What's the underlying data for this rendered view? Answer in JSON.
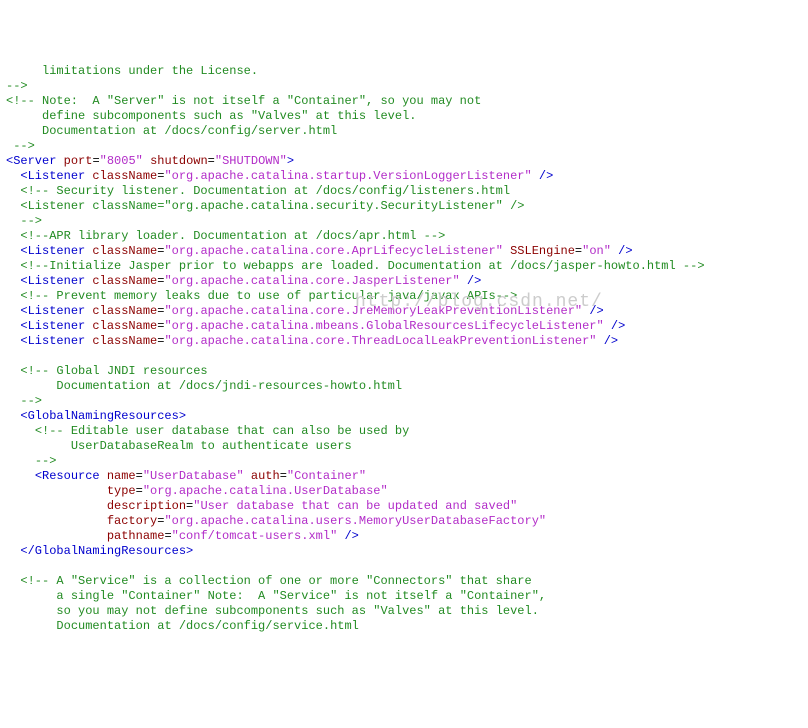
{
  "watermark": "http://blog.csdn.net/",
  "lines": [
    [
      {
        "cls": "c",
        "txt": "     limitations under the License."
      }
    ],
    [
      {
        "cls": "c",
        "txt": "-->"
      }
    ],
    [
      {
        "cls": "c",
        "txt": "<!-- Note:  A \"Server\" is not itself a \"Container\", so you may not"
      }
    ],
    [
      {
        "cls": "c",
        "txt": "     define subcomponents such as \"Valves\" at this level."
      }
    ],
    [
      {
        "cls": "c",
        "txt": "     Documentation at /docs/config/server.html"
      }
    ],
    [
      {
        "cls": "c",
        "txt": " -->"
      }
    ],
    [
      {
        "cls": "t",
        "txt": "<Server"
      },
      {
        "cls": "k",
        "txt": " "
      },
      {
        "cls": "a",
        "txt": "port"
      },
      {
        "cls": "k",
        "txt": "="
      },
      {
        "cls": "v",
        "txt": "\"8005\""
      },
      {
        "cls": "k",
        "txt": " "
      },
      {
        "cls": "a",
        "txt": "shutdown"
      },
      {
        "cls": "k",
        "txt": "="
      },
      {
        "cls": "v",
        "txt": "\"SHUTDOWN\""
      },
      {
        "cls": "t",
        "txt": ">"
      }
    ],
    [
      {
        "cls": "k",
        "txt": "  "
      },
      {
        "cls": "t",
        "txt": "<Listener"
      },
      {
        "cls": "k",
        "txt": " "
      },
      {
        "cls": "a",
        "txt": "className"
      },
      {
        "cls": "k",
        "txt": "="
      },
      {
        "cls": "v",
        "txt": "\"org.apache.catalina.startup.VersionLoggerListener\""
      },
      {
        "cls": "k",
        "txt": " "
      },
      {
        "cls": "t",
        "txt": "/>"
      }
    ],
    [
      {
        "cls": "k",
        "txt": "  "
      },
      {
        "cls": "c",
        "txt": "<!-- Security listener. Documentation at /docs/config/listeners.html"
      }
    ],
    [
      {
        "cls": "k",
        "txt": "  "
      },
      {
        "cls": "c",
        "txt": "<Listener className=\"org.apache.catalina.security.SecurityListener\" />"
      }
    ],
    [
      {
        "cls": "k",
        "txt": "  "
      },
      {
        "cls": "c",
        "txt": "-->"
      }
    ],
    [
      {
        "cls": "k",
        "txt": "  "
      },
      {
        "cls": "c",
        "txt": "<!--APR library loader. Documentation at /docs/apr.html -->"
      }
    ],
    [
      {
        "cls": "k",
        "txt": "  "
      },
      {
        "cls": "t",
        "txt": "<Listener"
      },
      {
        "cls": "k",
        "txt": " "
      },
      {
        "cls": "a",
        "txt": "className"
      },
      {
        "cls": "k",
        "txt": "="
      },
      {
        "cls": "v",
        "txt": "\"org.apache.catalina.core.AprLifecycleListener\""
      },
      {
        "cls": "k",
        "txt": " "
      },
      {
        "cls": "a",
        "txt": "SSLEngine"
      },
      {
        "cls": "k",
        "txt": "="
      },
      {
        "cls": "v",
        "txt": "\"on\""
      },
      {
        "cls": "k",
        "txt": " "
      },
      {
        "cls": "t",
        "txt": "/>"
      }
    ],
    [
      {
        "cls": "k",
        "txt": "  "
      },
      {
        "cls": "c",
        "txt": "<!--Initialize Jasper prior to webapps are loaded. Documentation at /docs/jasper-howto.html -->"
      }
    ],
    [
      {
        "cls": "k",
        "txt": "  "
      },
      {
        "cls": "t",
        "txt": "<Listener"
      },
      {
        "cls": "k",
        "txt": " "
      },
      {
        "cls": "a",
        "txt": "className"
      },
      {
        "cls": "k",
        "txt": "="
      },
      {
        "cls": "v",
        "txt": "\"org.apache.catalina.core.JasperListener\""
      },
      {
        "cls": "k",
        "txt": " "
      },
      {
        "cls": "t",
        "txt": "/>"
      }
    ],
    [
      {
        "cls": "k",
        "txt": "  "
      },
      {
        "cls": "c",
        "txt": "<!-- Prevent memory leaks due to use of particular java/javax APIs-->"
      }
    ],
    [
      {
        "cls": "k",
        "txt": "  "
      },
      {
        "cls": "t",
        "txt": "<Listener"
      },
      {
        "cls": "k",
        "txt": " "
      },
      {
        "cls": "a",
        "txt": "className"
      },
      {
        "cls": "k",
        "txt": "="
      },
      {
        "cls": "v",
        "txt": "\"org.apache.catalina.core.JreMemoryLeakPreventionListener\""
      },
      {
        "cls": "k",
        "txt": " "
      },
      {
        "cls": "t",
        "txt": "/>"
      }
    ],
    [
      {
        "cls": "k",
        "txt": "  "
      },
      {
        "cls": "t",
        "txt": "<Listener"
      },
      {
        "cls": "k",
        "txt": " "
      },
      {
        "cls": "a",
        "txt": "className"
      },
      {
        "cls": "k",
        "txt": "="
      },
      {
        "cls": "v",
        "txt": "\"org.apache.catalina.mbeans.GlobalResourcesLifecycleListener\""
      },
      {
        "cls": "k",
        "txt": " "
      },
      {
        "cls": "t",
        "txt": "/>"
      }
    ],
    [
      {
        "cls": "k",
        "txt": "  "
      },
      {
        "cls": "t",
        "txt": "<Listener"
      },
      {
        "cls": "k",
        "txt": " "
      },
      {
        "cls": "a",
        "txt": "className"
      },
      {
        "cls": "k",
        "txt": "="
      },
      {
        "cls": "v",
        "txt": "\"org.apache.catalina.core.ThreadLocalLeakPreventionListener\""
      },
      {
        "cls": "k",
        "txt": " "
      },
      {
        "cls": "t",
        "txt": "/>"
      }
    ],
    [
      {
        "cls": "k",
        "txt": ""
      }
    ],
    [
      {
        "cls": "k",
        "txt": "  "
      },
      {
        "cls": "c",
        "txt": "<!-- Global JNDI resources"
      }
    ],
    [
      {
        "cls": "k",
        "txt": "       "
      },
      {
        "cls": "c",
        "txt": "Documentation at /docs/jndi-resources-howto.html"
      }
    ],
    [
      {
        "cls": "k",
        "txt": "  "
      },
      {
        "cls": "c",
        "txt": "-->"
      }
    ],
    [
      {
        "cls": "k",
        "txt": "  "
      },
      {
        "cls": "t",
        "txt": "<GlobalNamingResources>"
      }
    ],
    [
      {
        "cls": "k",
        "txt": "    "
      },
      {
        "cls": "c",
        "txt": "<!-- Editable user database that can also be used by"
      }
    ],
    [
      {
        "cls": "k",
        "txt": "         "
      },
      {
        "cls": "c",
        "txt": "UserDatabaseRealm to authenticate users"
      }
    ],
    [
      {
        "cls": "k",
        "txt": "    "
      },
      {
        "cls": "c",
        "txt": "-->"
      }
    ],
    [
      {
        "cls": "k",
        "txt": "    "
      },
      {
        "cls": "t",
        "txt": "<Resource"
      },
      {
        "cls": "k",
        "txt": " "
      },
      {
        "cls": "a",
        "txt": "name"
      },
      {
        "cls": "k",
        "txt": "="
      },
      {
        "cls": "v",
        "txt": "\"UserDatabase\""
      },
      {
        "cls": "k",
        "txt": " "
      },
      {
        "cls": "a",
        "txt": "auth"
      },
      {
        "cls": "k",
        "txt": "="
      },
      {
        "cls": "v",
        "txt": "\"Container\""
      }
    ],
    [
      {
        "cls": "k",
        "txt": "              "
      },
      {
        "cls": "a",
        "txt": "type"
      },
      {
        "cls": "k",
        "txt": "="
      },
      {
        "cls": "v",
        "txt": "\"org.apache.catalina.UserDatabase\""
      }
    ],
    [
      {
        "cls": "k",
        "txt": "              "
      },
      {
        "cls": "a",
        "txt": "description"
      },
      {
        "cls": "k",
        "txt": "="
      },
      {
        "cls": "v",
        "txt": "\"User database that can be updated and saved\""
      }
    ],
    [
      {
        "cls": "k",
        "txt": "              "
      },
      {
        "cls": "a",
        "txt": "factory"
      },
      {
        "cls": "k",
        "txt": "="
      },
      {
        "cls": "v",
        "txt": "\"org.apache.catalina.users.MemoryUserDatabaseFactory\""
      }
    ],
    [
      {
        "cls": "k",
        "txt": "              "
      },
      {
        "cls": "a",
        "txt": "pathname"
      },
      {
        "cls": "k",
        "txt": "="
      },
      {
        "cls": "v",
        "txt": "\"conf/tomcat-users.xml\""
      },
      {
        "cls": "k",
        "txt": " "
      },
      {
        "cls": "t",
        "txt": "/>"
      }
    ],
    [
      {
        "cls": "k",
        "txt": "  "
      },
      {
        "cls": "t",
        "txt": "</GlobalNamingResources>"
      }
    ],
    [
      {
        "cls": "k",
        "txt": ""
      }
    ],
    [
      {
        "cls": "k",
        "txt": "  "
      },
      {
        "cls": "c",
        "txt": "<!-- A \"Service\" is a collection of one or more \"Connectors\" that share"
      }
    ],
    [
      {
        "cls": "k",
        "txt": "       "
      },
      {
        "cls": "c",
        "txt": "a single \"Container\" Note:  A \"Service\" is not itself a \"Container\","
      }
    ],
    [
      {
        "cls": "k",
        "txt": "       "
      },
      {
        "cls": "c",
        "txt": "so you may not define subcomponents such as \"Valves\" at this level."
      }
    ],
    [
      {
        "cls": "k",
        "txt": "       "
      },
      {
        "cls": "c",
        "txt": "Documentation at /docs/config/service.html"
      }
    ]
  ]
}
